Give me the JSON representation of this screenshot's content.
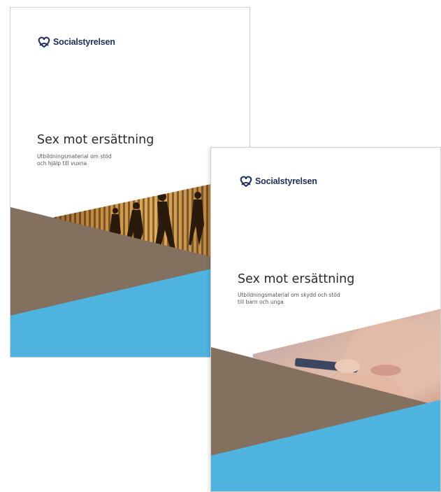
{
  "covers": [
    {
      "logo_text": "Socialstyrelsen",
      "title": "Sex mot ersättning",
      "subtitle_lines": [
        "Utbildningsmaterial om stöd",
        "och hjälp till vuxna"
      ]
    },
    {
      "logo_text": "Socialstyrelsen",
      "title": "Sex mot ersättning",
      "subtitle_lines": [
        "Utbildningsmaterial om skydd och stöd",
        "till barn och unga"
      ]
    }
  ],
  "colors": {
    "brown_band": "#83705f",
    "blue_band": "#4fb3e0",
    "logo_navy": "#1e2f5c"
  }
}
